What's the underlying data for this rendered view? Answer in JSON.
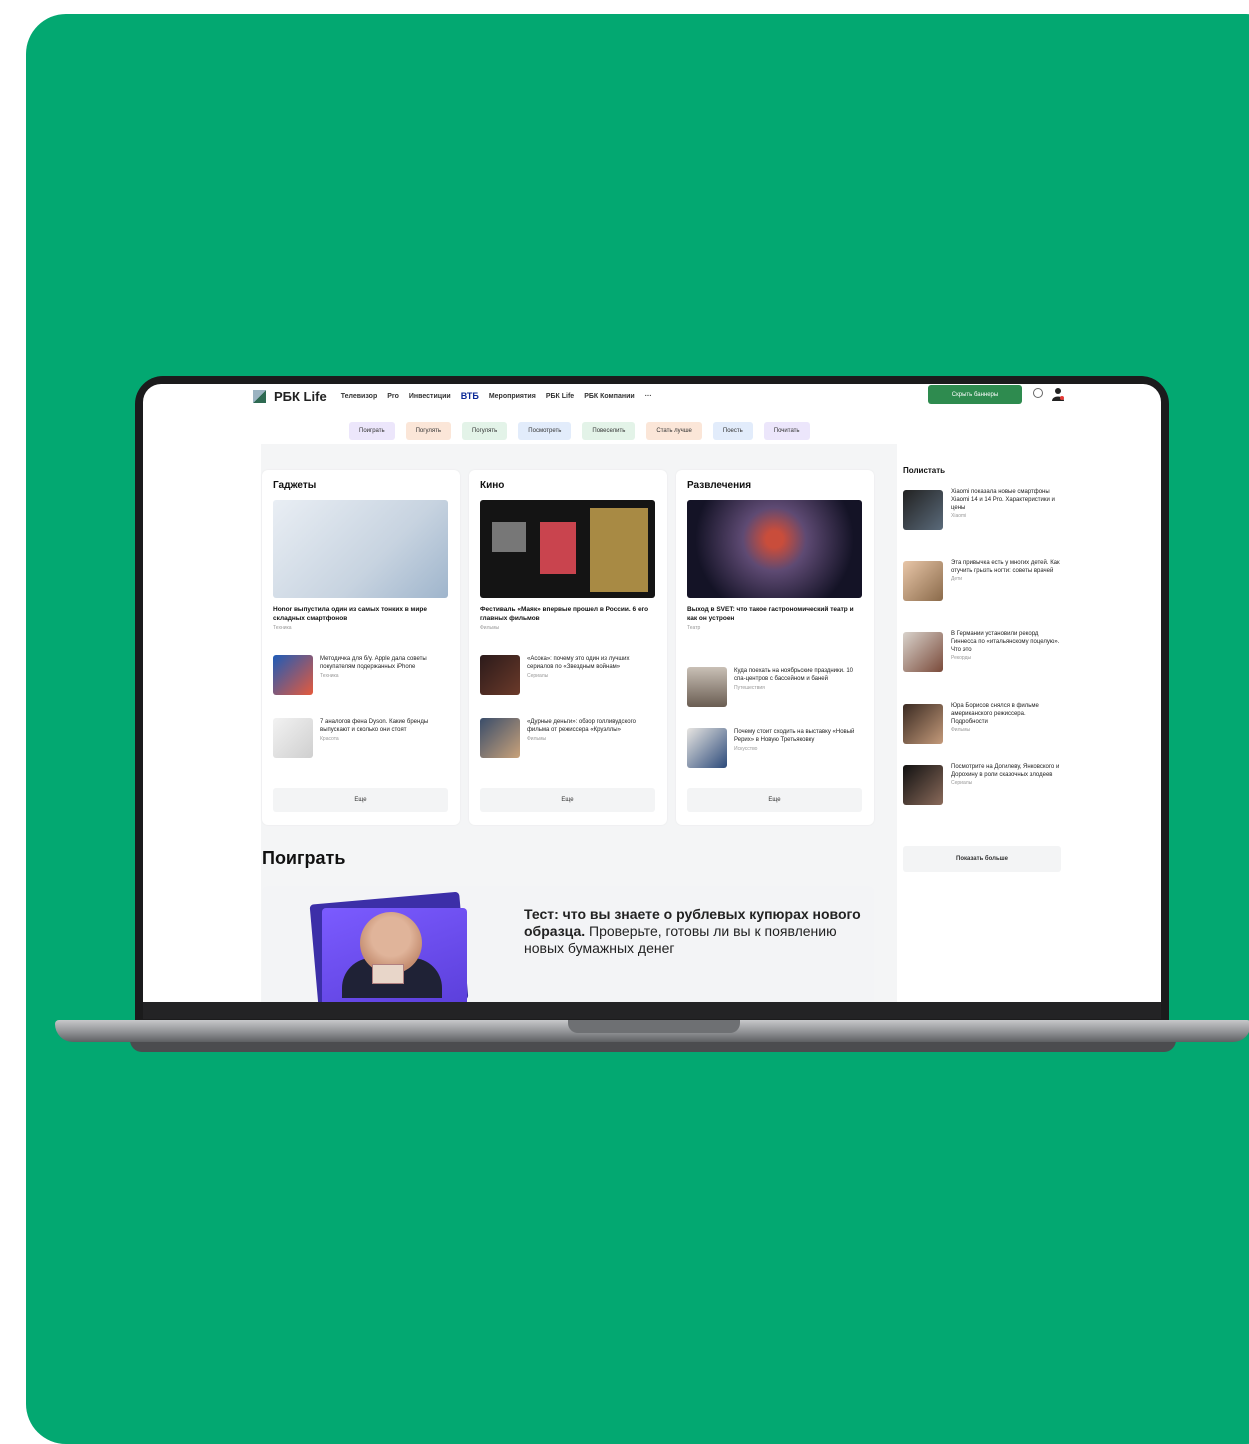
{
  "site": {
    "logo": "РБК Life",
    "nav": [
      "Телевизор",
      "Pro",
      "Инвестиции",
      "ВТБ",
      "Мероприятия",
      "РБК Life",
      "РБК Компании",
      "···"
    ],
    "hide_banners": "Скрыть баннеры",
    "chips": [
      {
        "label": "Поиграть",
        "color": "#ece6fb"
      },
      {
        "label": "Погулять",
        "color": "#fbe6d8"
      },
      {
        "label": "Погулять",
        "color": "#e3f3e8"
      },
      {
        "label": "Посмотреть",
        "color": "#e2ecfb"
      },
      {
        "label": "Повеселить",
        "color": "#e3f3e8"
      },
      {
        "label": "Стать лучше",
        "color": "#fbe6d8"
      },
      {
        "label": "Поесть",
        "color": "#e2ecfb"
      },
      {
        "label": "Почитать",
        "color": "#ece6fb"
      }
    ]
  },
  "cards": [
    {
      "title": "Гаджеты",
      "hero_title": "Honor выпустила один из самых тонких в мире складных смартфонов",
      "hero_cat": "Техника",
      "items": [
        {
          "text": "Методичка для б/у. Apple дала советы покупателям подержанных iPhone",
          "cat": "Техника"
        },
        {
          "text": "7 аналогов фена Dyson. Какие бренды выпускают и сколько они стоят",
          "cat": "Красота"
        }
      ],
      "more": "Еще"
    },
    {
      "title": "Кино",
      "hero_title": "Фестиваль «Маяк» впервые прошел в России. 6 его главных фильмов",
      "hero_cat": "Фильмы",
      "items": [
        {
          "text": "«Асока»: почему это один из лучших сериалов по «Звездным войнам»",
          "cat": "Сериалы"
        },
        {
          "text": "«Дурные деньги»: обзор голливудского фильма от режиссера «Круэллы»",
          "cat": "Фильмы"
        }
      ],
      "more": "Еще"
    },
    {
      "title": "Развлечения",
      "hero_title": "Выход в SVET: что такое гастрономический театр и как он устроен",
      "hero_cat": "Театр",
      "items": [
        {
          "text": "Куда поехать на ноябрьские праздники. 10 спа-центров с бассейном и баней",
          "cat": "Путешествия"
        },
        {
          "text": "Почему стоит сходить на выставку «Новый Рерих» в Новую Третьяковку",
          "cat": "Искусство"
        }
      ],
      "more": "Еще"
    }
  ],
  "sidebar": {
    "title": "Полистать",
    "items": [
      {
        "text": "Xiaomi показала новые смартфоны Xiaomi 14 и 14 Pro. Характеристики и цены",
        "cat": "Xiaomi"
      },
      {
        "text": "Эта привычка есть у многих детей. Как отучить грызть ногти: советы врачей",
        "cat": "Дети"
      },
      {
        "text": "В Германии установили рекорд Гиннесса по «итальянскому поцелую». Что это",
        "cat": "Рекорды"
      },
      {
        "text": "Юра Борисов снялся в фильме американского режиссера. Подробности",
        "cat": "Фильмы"
      },
      {
        "text": "Посмотрите на Догилеву, Янковского и Дорохину в роли сказочных злодеев",
        "cat": "Сериалы"
      }
    ],
    "show_more": "Показать больше"
  },
  "play": {
    "heading": "Поиграть",
    "quiz_bold": "Тест: что вы знаете о рублевых купюрах нового образца.",
    "quiz_rest": " Проверьте, готовы ли вы к появлению новых бумажных денег"
  }
}
